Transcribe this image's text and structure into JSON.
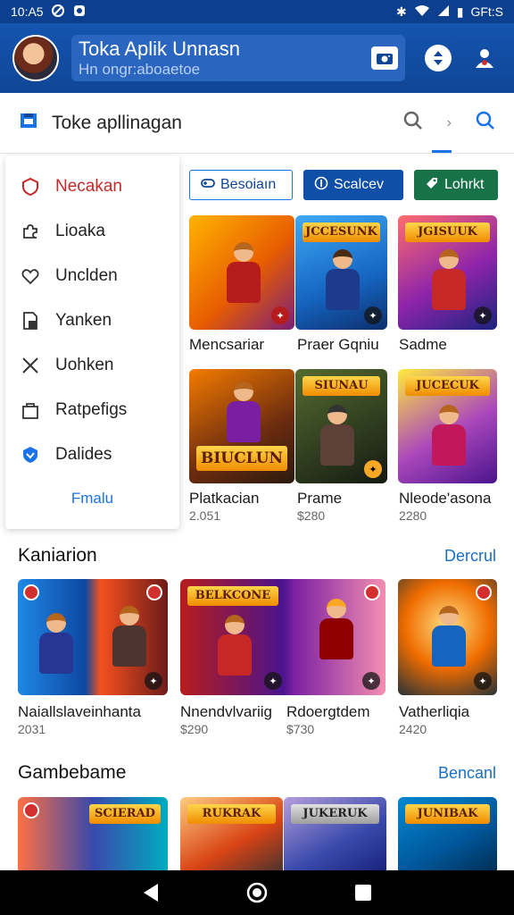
{
  "status_bar": {
    "time": "10:A5",
    "right_text": "GFt:S"
  },
  "header": {
    "title": "Toka Aplik Unnasn",
    "subtitle": "Hn ongr:aboaetoe"
  },
  "toolbar": {
    "label": "Toke apllinagan"
  },
  "drawer": {
    "items": [
      {
        "label": "Necakan",
        "icon": "shield-icon"
      },
      {
        "label": "Lioaka",
        "icon": "puzzle-icon"
      },
      {
        "label": "Unclden",
        "icon": "heart-icon"
      },
      {
        "label": "Yanken",
        "icon": "document-icon"
      },
      {
        "label": "Uohken",
        "icon": "close-icon"
      },
      {
        "label": "Ratpefigs",
        "icon": "bag-icon"
      },
      {
        "label": "Dalides",
        "icon": "shield-filled-icon"
      }
    ],
    "more_label": "Fmalu"
  },
  "chips": [
    {
      "label": "Besoiaın",
      "icon": "gamepad-icon"
    },
    {
      "label": "Scalcev",
      "icon": "info-icon"
    },
    {
      "label": "Lohrkt",
      "icon": "tag-icon"
    }
  ],
  "grid_top": [
    {
      "title": "Mencsariar",
      "sub": "",
      "banner": ""
    },
    {
      "title": "Praer Gqniu",
      "sub": "",
      "banner": "JCCESUNK"
    },
    {
      "title": "Sadme",
      "sub": "",
      "banner": "JGISUUK"
    },
    {
      "title": "Platkacian",
      "sub": "2.051",
      "banner": "BIUCLUN"
    },
    {
      "title": "Prame",
      "sub": "$280",
      "banner": "SIUNAU"
    },
    {
      "title": "Nleode'asona",
      "sub": "2280",
      "banner": "JUCECUK"
    }
  ],
  "section1": {
    "title": "Kaniarion",
    "more": "Dercrul",
    "items": [
      {
        "title": "Naiallslaveinhanta",
        "sub": "2031",
        "banner": ""
      },
      {
        "title": "Nnendvlvariig",
        "sub": "$290",
        "banner": "BELKCONE"
      },
      {
        "title": "Rdoergtdem",
        "sub": "$730",
        "banner": ""
      },
      {
        "title": "Vatherliqia",
        "sub": "2420",
        "banner": ""
      }
    ]
  },
  "section2": {
    "title": "Gambebame",
    "more": "Bencanl",
    "items": [
      {
        "banner": "SCIERAD"
      },
      {
        "banner": "RUKRAK"
      },
      {
        "banner": "JUKERUK"
      },
      {
        "banner": "JUNIBAK"
      }
    ]
  },
  "colors": {
    "primary": "#0f4596",
    "accent": "#1a73e8",
    "chip_green": "#177248",
    "active": "#c62828"
  }
}
